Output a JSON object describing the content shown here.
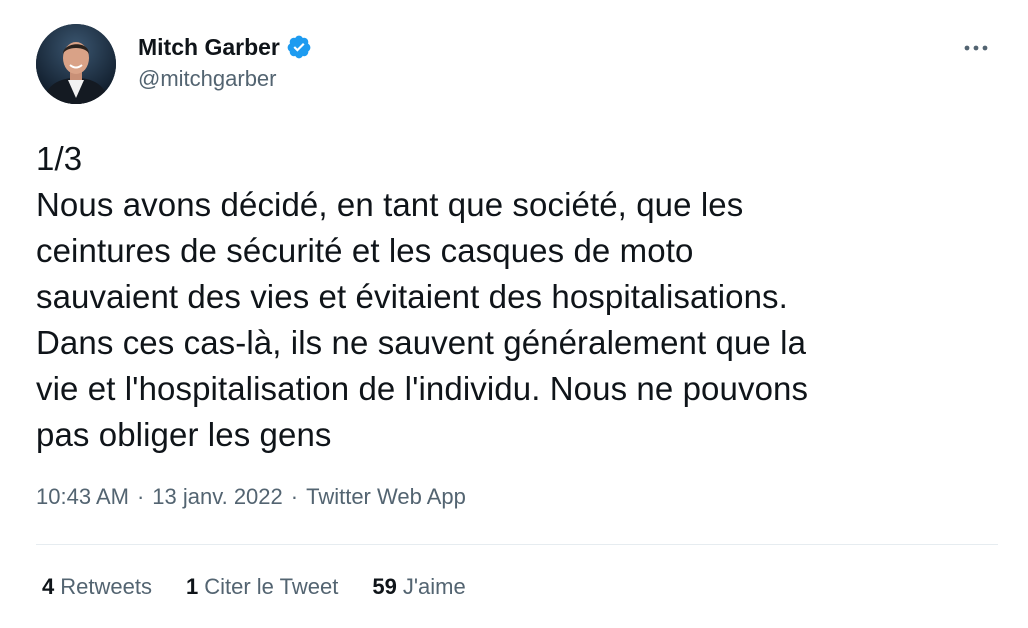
{
  "author": {
    "display_name": "Mitch Garber",
    "handle": "@mitchgarber",
    "verified_icon": "verified-badge-icon",
    "verified_color": "#1d9bf0"
  },
  "tweet": {
    "text": "1/3\nNous avons décidé, en tant que société, que les\nceintures de sécurité et les casques de moto\nsauvaient des vies et évitaient des hospitalisations.\nDans ces cas-là, ils ne sauvent généralement que la\nvie et l'hospitalisation de l'individu. Nous ne pouvons\npas obliger les gens",
    "time": "10:43 AM",
    "separator1": "·",
    "date": "13 janv. 2022",
    "separator2": "·",
    "source": "Twitter Web App"
  },
  "stats": {
    "retweets_count": "4",
    "retweets_label": "Retweets",
    "quotes_count": "1",
    "quotes_label": "Citer le Tweet",
    "likes_count": "59",
    "likes_label": "J'aime"
  },
  "menu": {
    "more_icon": "more-horizontal-icon"
  }
}
